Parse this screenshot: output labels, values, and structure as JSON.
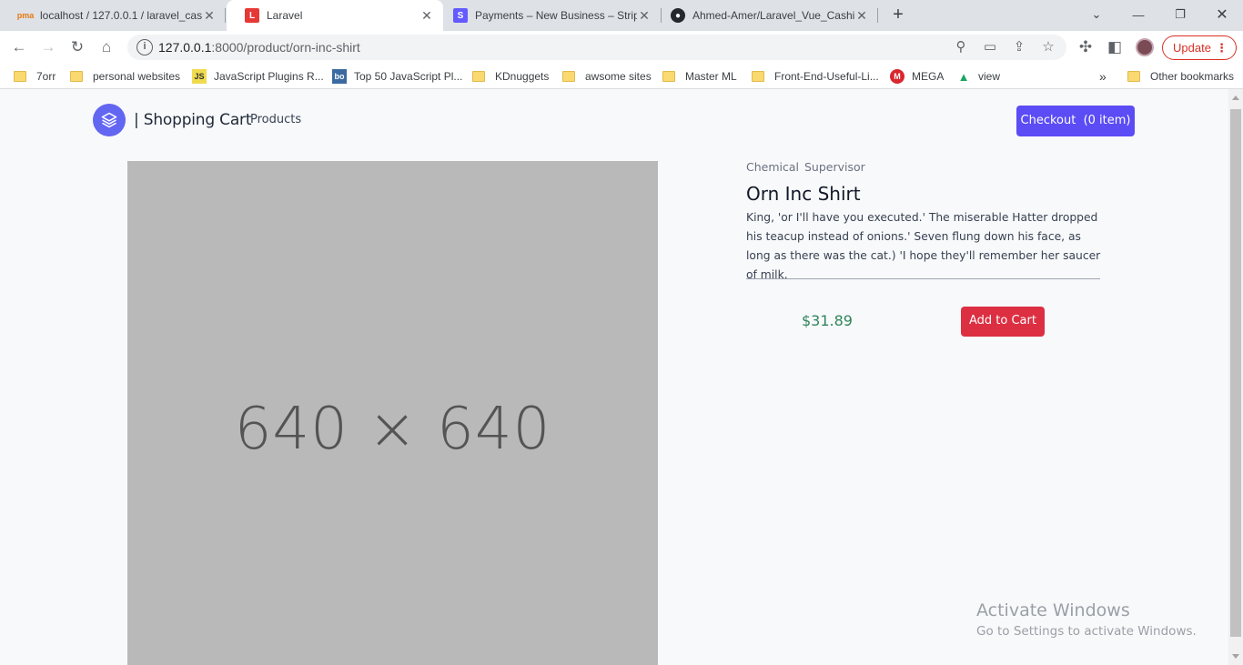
{
  "browser": {
    "tabs": [
      {
        "title": "localhost / 127.0.0.1 / laravel_cas",
        "favicon": "phpmyadmin-icon",
        "active": false
      },
      {
        "title": "Laravel",
        "favicon": "laravel-icon",
        "active": true
      },
      {
        "title": "Payments – New Business – Strip",
        "favicon": "stripe-icon",
        "active": false
      },
      {
        "title": "Ahmed-Amer/Laravel_Vue_Cashi",
        "favicon": "github-icon",
        "active": false
      }
    ],
    "url_host": "127.0.0.1",
    "url_path": ":8000/product/orn-inc-shirt",
    "update_label": "Update",
    "bookmarks": [
      {
        "label": "7orr",
        "icon": "folder-icon"
      },
      {
        "label": "personal websites",
        "icon": "folder-icon"
      },
      {
        "label": "JavaScript Plugins R...",
        "icon": "js-icon"
      },
      {
        "label": "Top 50 JavaScript Pl...",
        "icon": "bo-icon"
      },
      {
        "label": "KDnuggets",
        "icon": "folder-icon"
      },
      {
        "label": "awsome sites",
        "icon": "folder-icon"
      },
      {
        "label": "Master ML",
        "icon": "folder-icon"
      },
      {
        "label": "Front-End-Useful-Li...",
        "icon": "folder-icon"
      },
      {
        "label": "MEGA",
        "icon": "mega-icon"
      },
      {
        "label": "view",
        "icon": "google-drive-icon"
      }
    ],
    "other_bookmarks": "Other bookmarks"
  },
  "navbar": {
    "brand": "| Shopping Cart",
    "nav_link": "Products",
    "checkout_label": "Checkout  (0 item)"
  },
  "product": {
    "image_placeholder": "640 × 640",
    "tags": [
      "Chemical",
      "Supervisor"
    ],
    "title": "Orn Inc Shirt",
    "description": "King, 'or I'll have you executed.' The miserable Hatter dropped his teacup instead of onions.' Seven flung down his face, as long as there was the cat.) 'I hope they'll remember her saucer of milk.",
    "price": "$31.89",
    "add_to_cart_label": "Add to Cart"
  },
  "watermark": {
    "line1": "Activate Windows",
    "line2": "Go to Settings to activate Windows."
  },
  "colors": {
    "brand_accent": "#6366f1",
    "checkout_bg": "#5b4cf5",
    "add_cart_bg": "#dc2f41",
    "price_color": "#2f855a"
  }
}
